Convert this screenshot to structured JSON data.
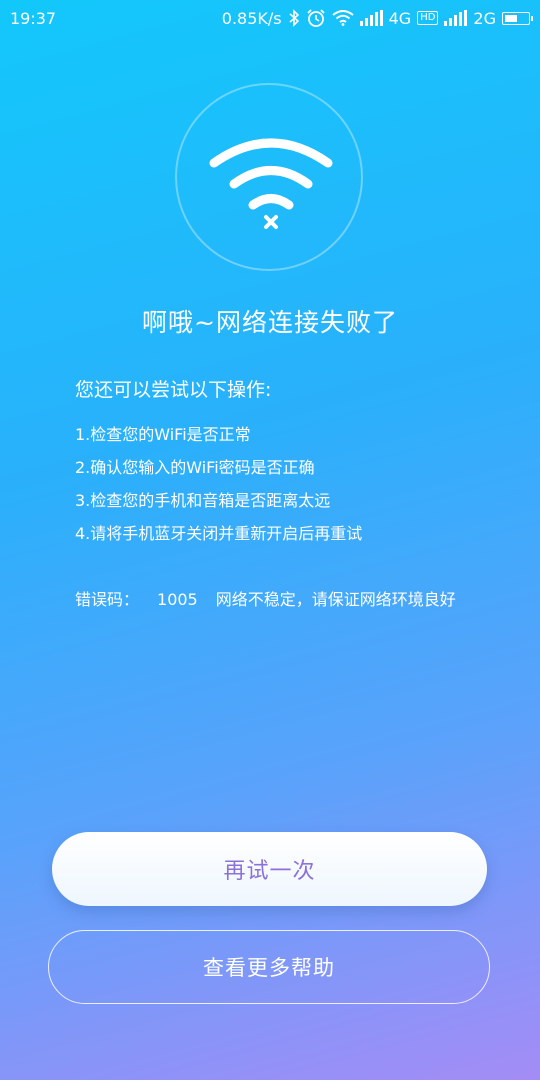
{
  "status_bar": {
    "time": "19:37",
    "net_speed": "0.85K/s",
    "signal1_type": "4G",
    "hd_badge": "HD",
    "signal2_type": "2G",
    "battery_level": 0.55,
    "icons": [
      "bluetooth-icon",
      "alarm-icon",
      "wifi-icon",
      "signal-icon",
      "battery-icon"
    ]
  },
  "main": {
    "title": "啊哦~网络连接失败了",
    "subtitle": "您还可以尝试以下操作:",
    "steps": [
      "1.检查您的WiFi是否正常",
      "2.确认您输入的WiFi密码是否正确",
      "3.检查您的手机和音箱是否距离太远",
      "4.请将手机蓝牙关闭并重新开启后再重试"
    ],
    "error": {
      "label": "错误码：",
      "code": "1005",
      "message": "网络不稳定，请保证网络环境良好"
    }
  },
  "actions": {
    "retry_label": "再试一次",
    "help_label": "查看更多帮助"
  },
  "colors": {
    "gradient_top": "#12c8fb",
    "gradient_bottom": "#a48cf6",
    "retry_text": "#8a72d8"
  }
}
